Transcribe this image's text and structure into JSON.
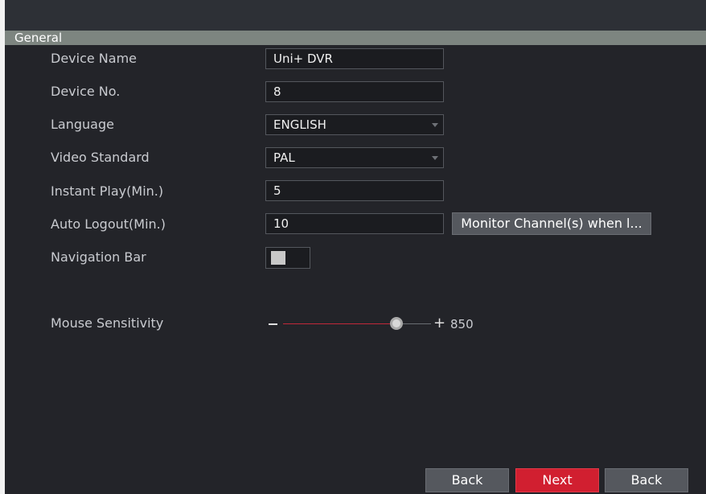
{
  "section": {
    "title": "General"
  },
  "fields": {
    "device_name": {
      "label": "Device Name",
      "value": "Uni+ DVR"
    },
    "device_no": {
      "label": "Device No.",
      "value": "8"
    },
    "language": {
      "label": "Language",
      "value": "ENGLISH"
    },
    "video_standard": {
      "label": "Video Standard",
      "value": "PAL"
    },
    "instant_play": {
      "label": "Instant Play(Min.)",
      "value": "5"
    },
    "auto_logout": {
      "label": "Auto Logout(Min.)",
      "value": "10",
      "button_label": "Monitor Channel(s) when l..."
    },
    "navigation_bar": {
      "label": "Navigation Bar",
      "enabled": false
    },
    "mouse_sensitivity": {
      "label": "Mouse Sensitivity",
      "minus": "–",
      "plus": "+",
      "value": "850",
      "position_fraction": 0.77
    }
  },
  "footer": {
    "back_label": "Back",
    "next_label": "Next",
    "back2_label": "Back"
  },
  "colors": {
    "accent": "#d11f30",
    "background": "#232429",
    "header_bar": "#7d8580"
  }
}
